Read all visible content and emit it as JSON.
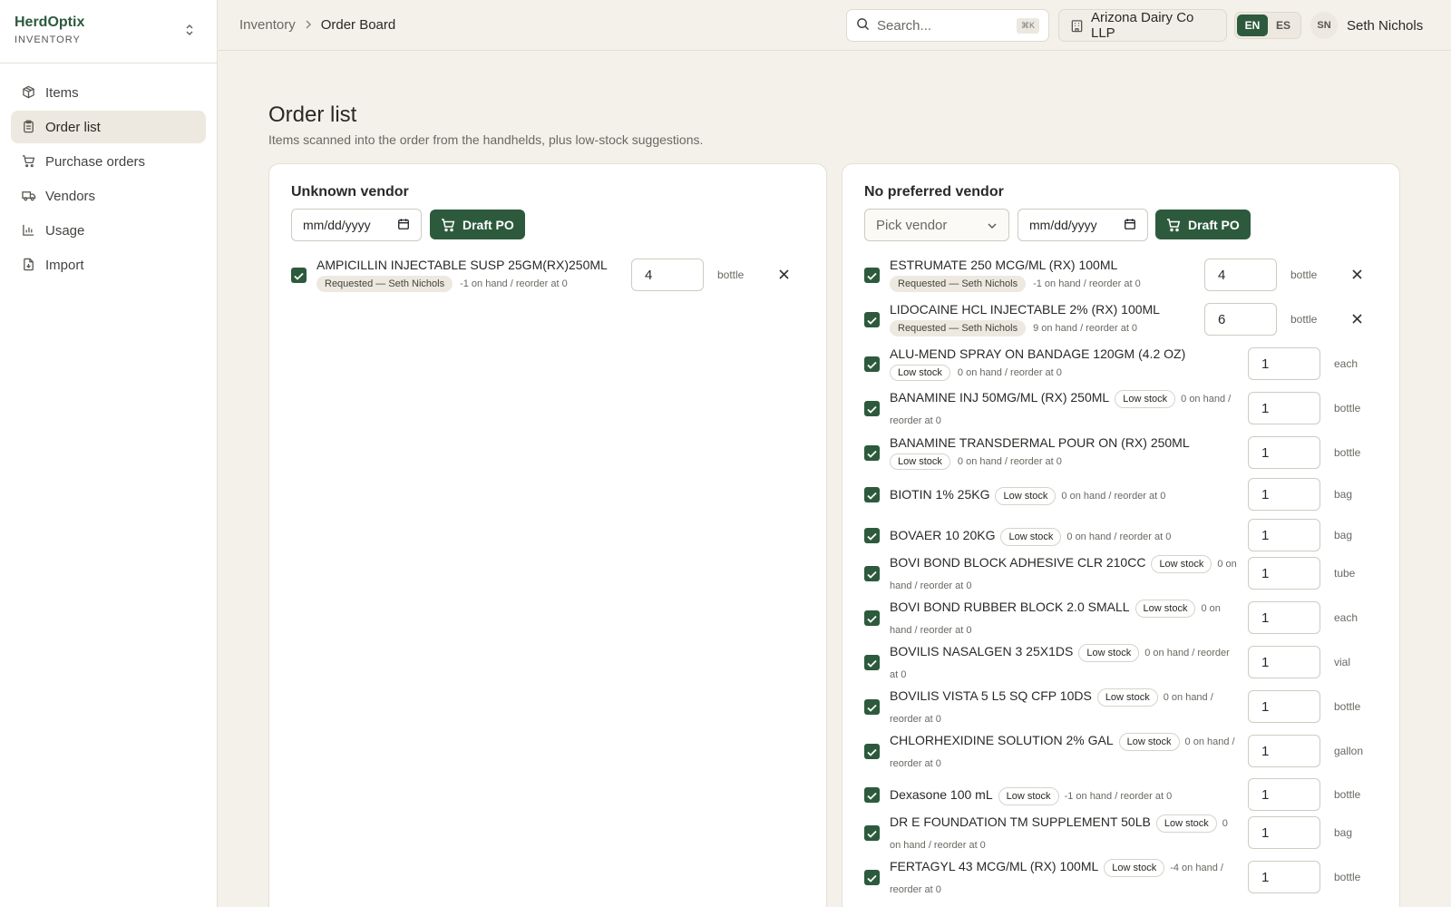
{
  "brand": {
    "name": "HerdOptix",
    "sub": "INVENTORY"
  },
  "nav": [
    {
      "label": "Items",
      "icon": "package-icon",
      "active": false
    },
    {
      "label": "Order list",
      "icon": "clipboard-icon",
      "active": true
    },
    {
      "label": "Purchase orders",
      "icon": "cart-icon",
      "active": false
    },
    {
      "label": "Vendors",
      "icon": "truck-icon",
      "active": false
    },
    {
      "label": "Usage",
      "icon": "bar-chart-icon",
      "active": false
    },
    {
      "label": "Import",
      "icon": "file-import-icon",
      "active": false
    }
  ],
  "header": {
    "breadcrumb": [
      "Inventory",
      "Order Board"
    ],
    "search_placeholder": "Search...",
    "search_shortcut": "⌘K",
    "org": "Arizona Dairy Co LLP",
    "lang": [
      "EN",
      "ES"
    ],
    "lang_active": "EN",
    "user_initials": "SN",
    "user_name": "Seth Nichols"
  },
  "page": {
    "title": "Order list",
    "subtitle": "Items scanned into the order from the handhelds, plus low-stock suggestions."
  },
  "colors": {
    "accent": "#2d5a3d",
    "background": "#f4f1ea"
  },
  "panels": {
    "left": {
      "title": "Unknown vendor",
      "date_placeholder": "mm/dd/yyyy",
      "draft_label": "Draft PO",
      "items": [
        {
          "name": "AMPICILLIN INJECTABLE SUSP 25GM(RX)250ML",
          "badge": "Requested — Seth Nichols",
          "badge_type": "requested",
          "stock": "-1 on hand / reorder at 0",
          "qty": "4",
          "unit": "bottle",
          "removable": true,
          "checked": true
        }
      ]
    },
    "right": {
      "title": "No preferred vendor",
      "vendor_placeholder": "Pick vendor",
      "date_placeholder": "mm/dd/yyyy",
      "draft_label": "Draft PO",
      "items": [
        {
          "name": "ESTRUMATE 250 MCG/ML (RX) 100ML",
          "badge": "Requested — Seth Nichols",
          "badge_type": "requested",
          "stock": "-1 on hand / reorder at 0",
          "qty": "4",
          "unit": "bottle",
          "removable": true,
          "checked": true
        },
        {
          "name": "LIDOCAINE HCL INJECTABLE 2% (RX) 100ML",
          "badge": "Requested — Seth Nichols",
          "badge_type": "requested",
          "stock": "9 on hand / reorder at 0",
          "qty": "6",
          "unit": "bottle",
          "removable": true,
          "checked": true
        },
        {
          "name": "ALU-MEND SPRAY ON BANDAGE 120GM (4.2 OZ)",
          "badge": "Low stock",
          "badge_type": "low",
          "stock": "0 on hand / reorder at 0",
          "qty": "1",
          "unit": "each",
          "removable": false,
          "checked": true
        },
        {
          "name": "BANAMINE INJ 50MG/ML (RX) 250ML",
          "badge": "Low stock",
          "badge_type": "low",
          "stock": "0 on hand / reorder at 0",
          "qty": "1",
          "unit": "bottle",
          "removable": false,
          "checked": true
        },
        {
          "name": "BANAMINE TRANSDERMAL POUR ON (RX) 250ML",
          "badge": "Low stock",
          "badge_type": "low",
          "stock": "0 on hand / reorder at 0",
          "qty": "1",
          "unit": "bottle",
          "removable": false,
          "checked": true
        },
        {
          "name": "BIOTIN 1% 25KG",
          "badge": "Low stock",
          "badge_type": "low",
          "stock": "0 on hand / reorder at 0",
          "qty": "1",
          "unit": "bag",
          "removable": false,
          "checked": true
        },
        {
          "name": "BOVAER 10 20KG",
          "badge": "Low stock",
          "badge_type": "low",
          "stock": "0 on hand / reorder at 0",
          "qty": "1",
          "unit": "bag",
          "removable": false,
          "checked": true
        },
        {
          "name": "BOVI BOND BLOCK ADHESIVE CLR 210CC",
          "badge": "Low stock",
          "badge_type": "low",
          "stock": "0 on hand / reorder at 0",
          "qty": "1",
          "unit": "tube",
          "removable": false,
          "checked": true
        },
        {
          "name": "BOVI BOND RUBBER BLOCK 2.0 SMALL",
          "badge": "Low stock",
          "badge_type": "low",
          "stock": "0 on hand / reorder at 0",
          "qty": "1",
          "unit": "each",
          "removable": false,
          "checked": true
        },
        {
          "name": "BOVILIS NASALGEN 3 25X1DS",
          "badge": "Low stock",
          "badge_type": "low",
          "stock": "0 on hand / reorder at 0",
          "qty": "1",
          "unit": "vial",
          "removable": false,
          "checked": true
        },
        {
          "name": "BOVILIS VISTA 5 L5 SQ CFP 10DS",
          "badge": "Low stock",
          "badge_type": "low",
          "stock": "0 on hand / reorder at 0",
          "qty": "1",
          "unit": "bottle",
          "removable": false,
          "checked": true
        },
        {
          "name": "CHLORHEXIDINE SOLUTION 2% GAL",
          "badge": "Low stock",
          "badge_type": "low",
          "stock": "0 on hand / reorder at 0",
          "qty": "1",
          "unit": "gallon",
          "removable": false,
          "checked": true
        },
        {
          "name": "Dexasone 100 mL",
          "badge": "Low stock",
          "badge_type": "low",
          "stock": "-1 on hand / reorder at 0",
          "qty": "1",
          "unit": "bottle",
          "removable": false,
          "checked": true
        },
        {
          "name": "DR E FOUNDATION TM SUPPLEMENT 50LB",
          "badge": "Low stock",
          "badge_type": "low",
          "stock": "0 on hand / reorder at 0",
          "qty": "1",
          "unit": "bag",
          "removable": false,
          "checked": true
        },
        {
          "name": "FERTAGYL 43 MCG/ML (RX) 100ML",
          "badge": "Low stock",
          "badge_type": "low",
          "stock": "-4 on hand / reorder at 0",
          "qty": "1",
          "unit": "bottle",
          "removable": false,
          "checked": true
        }
      ]
    }
  }
}
